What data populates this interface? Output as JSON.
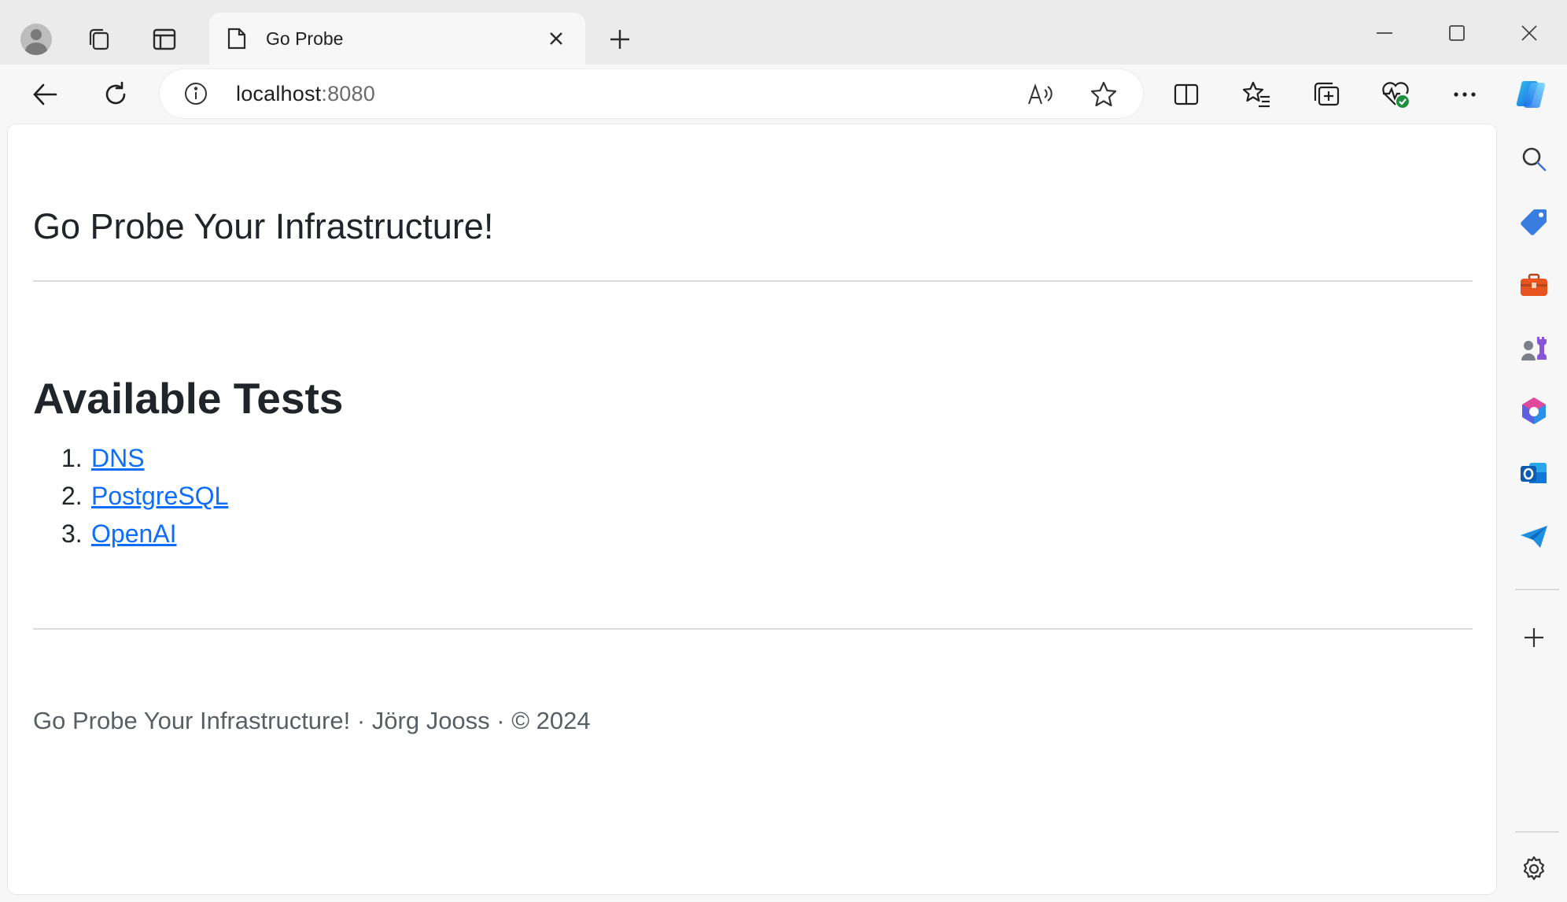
{
  "browser": {
    "tab": {
      "title": "Go Probe"
    },
    "address_bar": {
      "host": "localhost",
      "port": ":8080"
    }
  },
  "page": {
    "title": "Go Probe Your Infrastructure!",
    "section_title": "Available Tests",
    "tests": [
      {
        "number": "1.",
        "label": "DNS"
      },
      {
        "number": "2.",
        "label": "PostgreSQL"
      },
      {
        "number": "3.",
        "label": "OpenAI"
      }
    ],
    "footer": "Go Probe Your Infrastructure! · Jörg Jooss · © 2024",
    "link_color": "#0d6efd"
  },
  "icons": {
    "titlebar": [
      "profile-avatar-icon",
      "workspaces-icon",
      "vertical-tabs-icon",
      "page-icon",
      "close-icon",
      "plus-icon",
      "minimize-icon",
      "maximize-icon",
      "close-window-icon"
    ],
    "toolbar": [
      "back-arrow-icon",
      "refresh-icon",
      "info-icon",
      "read-aloud-icon",
      "star-icon",
      "split-screen-icon",
      "favorites-icon",
      "collections-icon",
      "browser-essentials-icon",
      "more-icon",
      "copilot-icon"
    ],
    "sidebar": [
      "search-icon",
      "shopping-tag-icon",
      "toolbox-icon",
      "games-icon",
      "microsoft-365-icon",
      "outlook-icon",
      "send-icon",
      "plus-icon",
      "gear-icon"
    ]
  }
}
